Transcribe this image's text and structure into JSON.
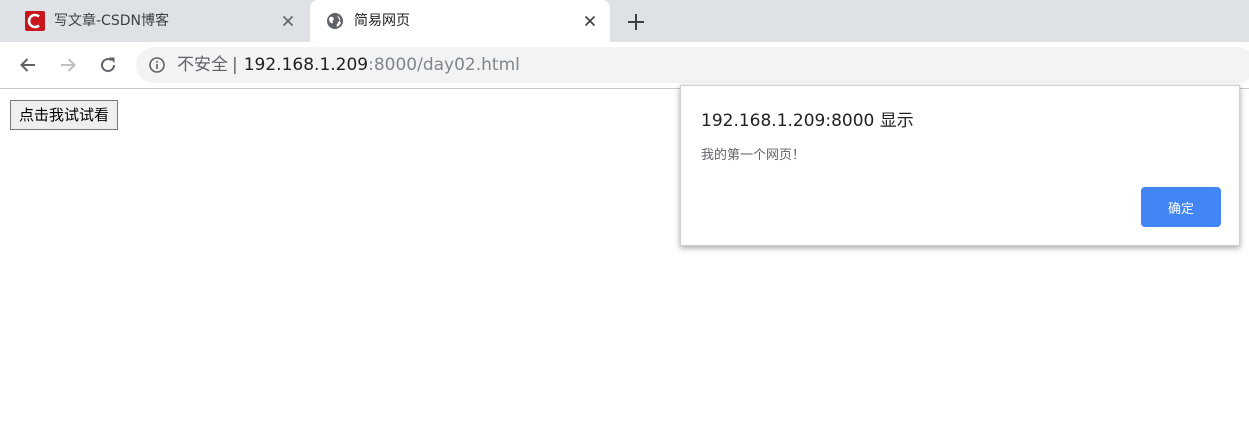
{
  "tabs": [
    {
      "title": "写文章-CSDN博客",
      "icon": "csdn-logo",
      "active": false
    },
    {
      "title": "简易网页",
      "icon": "globe-icon",
      "active": true
    }
  ],
  "toolbar": {
    "security_label": "不安全",
    "separator": "|",
    "url_host": "192.168.1.209",
    "url_rest": ":8000/day02.html"
  },
  "page": {
    "button_label": "点击我试试看"
  },
  "dialog": {
    "title": "192.168.1.209:8000 显示",
    "message": "我的第一个网页！",
    "ok_label": "确定"
  },
  "colors": {
    "tabstrip_bg": "#dee1e6",
    "omnibox_bg": "#f1f3f4",
    "primary_button": "#4285f4",
    "csdn_red": "#c8161d"
  }
}
